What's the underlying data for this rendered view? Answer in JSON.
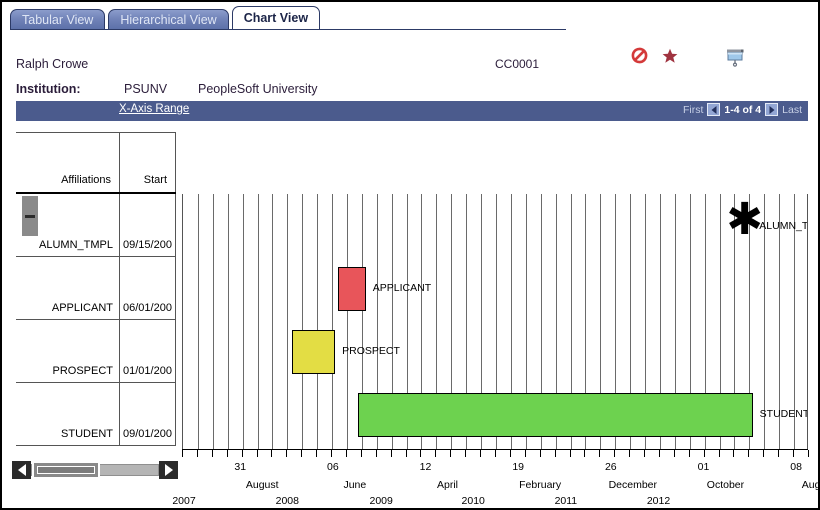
{
  "tabs": [
    {
      "label": "Tabular View",
      "active": false
    },
    {
      "label": "Hierarchical View",
      "active": false
    },
    {
      "label": "Chart View",
      "active": true
    }
  ],
  "header": {
    "person_name": "Ralph Crowe",
    "emplid": "CC0001",
    "institution_label": "Institution:",
    "institution_code": "PSUNV",
    "institution_desc": "PeopleSoft University",
    "icons": [
      {
        "name": "no-entry-icon",
        "color": "#d43a3a"
      },
      {
        "name": "star-icon",
        "color": "#a03340"
      },
      {
        "name": "projector-screen-icon",
        "color": "#7fa8d8"
      }
    ]
  },
  "toolbar": {
    "xaxis_range_link": "X-Axis Range",
    "nav_first": "First",
    "nav_count": "1-4 of 4",
    "nav_last": "Last"
  },
  "table": {
    "columns": [
      "Affiliations",
      "Start"
    ],
    "rows": [
      {
        "affiliation": "ALUMN_TMPL",
        "start": "09/15/200",
        "has_tree_toggle": true
      },
      {
        "affiliation": "APPLICANT",
        "start": "06/01/200",
        "has_tree_toggle": false
      },
      {
        "affiliation": "PROSPECT",
        "start": "01/01/200",
        "has_tree_toggle": false
      },
      {
        "affiliation": "STUDENT",
        "start": "09/01/200",
        "has_tree_toggle": false
      }
    ]
  },
  "chart_data": {
    "type": "bar",
    "title": "",
    "xlabel": "",
    "ylabel": "",
    "orientation": "horizontal-gantt",
    "grid": true,
    "legend": "inline-labels",
    "categories": [
      "ALUMN_TMPL",
      "APPLICANT",
      "PROSPECT",
      "STUDENT"
    ],
    "series": [
      {
        "name": "ALUMN_TMPL",
        "marker": "asterisk",
        "color": "#000000",
        "label": "ALUMN_TM",
        "point_x_fraction": 0.895,
        "start": "09/15/200"
      },
      {
        "name": "APPLICANT",
        "marker": "bar",
        "color": "#e8555a",
        "label": "APPLICANT",
        "x_start_fraction": 0.247,
        "x_end_fraction": 0.292,
        "start": "06/01/200"
      },
      {
        "name": "PROSPECT",
        "marker": "bar",
        "color": "#e3dd44",
        "label": "PROSPECT",
        "x_start_fraction": 0.174,
        "x_end_fraction": 0.243,
        "start": "01/01/200"
      },
      {
        "name": "STUDENT",
        "marker": "bar",
        "color": "#6dd24f",
        "label": "STUDENT",
        "x_start_fraction": 0.279,
        "x_end_fraction": 0.91,
        "start": "09/01/200"
      }
    ],
    "x_axis": {
      "ticks_total": 42,
      "labels": [
        {
          "day": "31",
          "month": "August",
          "year": "2007",
          "fraction": 0.093
        },
        {
          "day": "06",
          "month": "June",
          "year": "2008",
          "fraction": 0.241
        },
        {
          "day": "12",
          "month": "April",
          "year": "2009",
          "fraction": 0.389
        },
        {
          "day": "19",
          "month": "February",
          "year": "2010",
          "fraction": 0.537
        },
        {
          "day": "26",
          "month": "December",
          "year": "2011",
          "fraction": 0.685
        },
        {
          "day": "01",
          "month": "October",
          "year": "2012",
          "fraction": 0.833
        },
        {
          "day": "08",
          "month": "August",
          "year": "",
          "fraction": 0.981
        }
      ],
      "year_labels": [
        {
          "text": "2007",
          "fraction": 0.0
        },
        {
          "text": "2008",
          "fraction": 0.165
        },
        {
          "text": "2009",
          "fraction": 0.315
        },
        {
          "text": "2010",
          "fraction": 0.462
        },
        {
          "text": "2011",
          "fraction": 0.61
        },
        {
          "text": "2012",
          "fraction": 0.758
        }
      ]
    }
  },
  "scrollbar": {
    "name": "horizontal-scrollbar",
    "position": "left",
    "thumb_fraction": 0.16
  }
}
